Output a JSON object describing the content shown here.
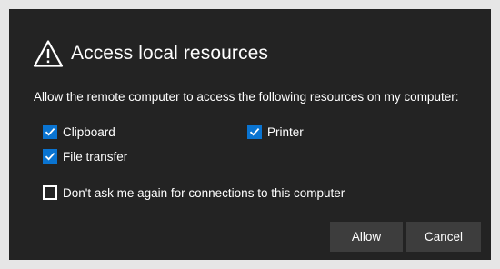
{
  "dialog": {
    "title": "Access local resources",
    "warning_icon": "warning-triangle-icon",
    "description": "Allow the remote computer to access the following resources on my computer:"
  },
  "resources": [
    {
      "label": "Clipboard",
      "checked": true
    },
    {
      "label": "Printer",
      "checked": true
    },
    {
      "label": "File transfer",
      "checked": true
    }
  ],
  "dont_ask": {
    "label": "Don't ask me again for connections to this computer",
    "checked": false
  },
  "buttons": {
    "allow": "Allow",
    "cancel": "Cancel"
  },
  "colors": {
    "dialog_bg": "#232323",
    "checkbox_accent": "#0a74d1",
    "button_bg": "#3d3d3d",
    "page_bg": "#e6e6e6"
  }
}
